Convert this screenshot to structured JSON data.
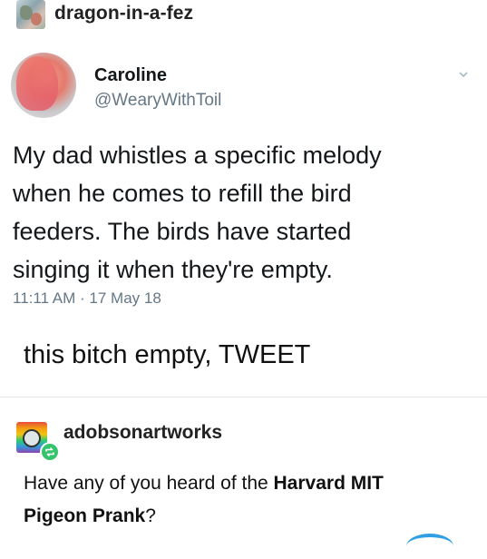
{
  "post": {
    "username": "dragon-in-a-fez"
  },
  "tweet": {
    "name": "Caroline",
    "handle": "@WearyWithToil",
    "lines": [
      "My dad whistles a specific melody",
      "when he comes to refill the bird",
      "feeders. The birds have started",
      "singing it when they're empty."
    ],
    "timestamp": "11:11 AM · 17 May 18"
  },
  "caption": "this bitch empty, TWEET",
  "reblog": {
    "username": "adobsonartworks",
    "text_line1_a": "Have any of you heard of the ",
    "text_line1_b": "Harvard MIT",
    "text_line2_a": "Pigeon Prank",
    "text_line2_b": "?"
  },
  "colors": {
    "twitter_gray": "#657786",
    "reblog_green": "#35c36b",
    "accent_blue": "#2f9fe3"
  }
}
